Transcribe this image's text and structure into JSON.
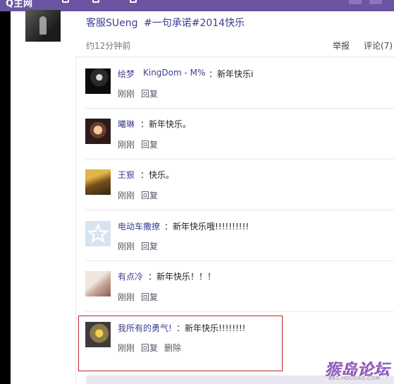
{
  "topbar": {
    "nav_text": "Q主网"
  },
  "post": {
    "author": "客服SUeng",
    "text": "#一句承诺#2014快乐",
    "time": "约12分钟前",
    "report": "举报",
    "comment": "评论(7)"
  },
  "comments": [
    {
      "user": "绘梦",
      "reply_to": "KingDom - M%",
      "text": "：新年快乐i",
      "actions": [
        "刚刚",
        "回复"
      ]
    },
    {
      "user": "曦琳",
      "text": "：新年快乐。",
      "actions": [
        "刚刚",
        "回复"
      ]
    },
    {
      "user": "王狠",
      "text": "：快乐。",
      "actions": [
        "刚刚",
        "回复"
      ]
    },
    {
      "user": "电动车撒撩",
      "text": "：新年快乐哦!!!!!!!!!!",
      "actions": [
        "刚刚",
        "回复"
      ]
    },
    {
      "user": "有点冷",
      "text": "：新年快乐！！！",
      "actions": [
        "刚刚",
        "回复"
      ]
    },
    {
      "user": "我所有的勇气!",
      "text": "：新年快乐!!!!!!!!",
      "actions": [
        "刚刚",
        "回复",
        "删除"
      ]
    }
  ],
  "watermark": {
    "title": "猴岛论坛",
    "subtitle": "BBS.HOUDAO.COM"
  },
  "colors": {
    "topbar": "#6b55a2",
    "link": "#3b3f8f",
    "highlight_border": "#c42226"
  }
}
